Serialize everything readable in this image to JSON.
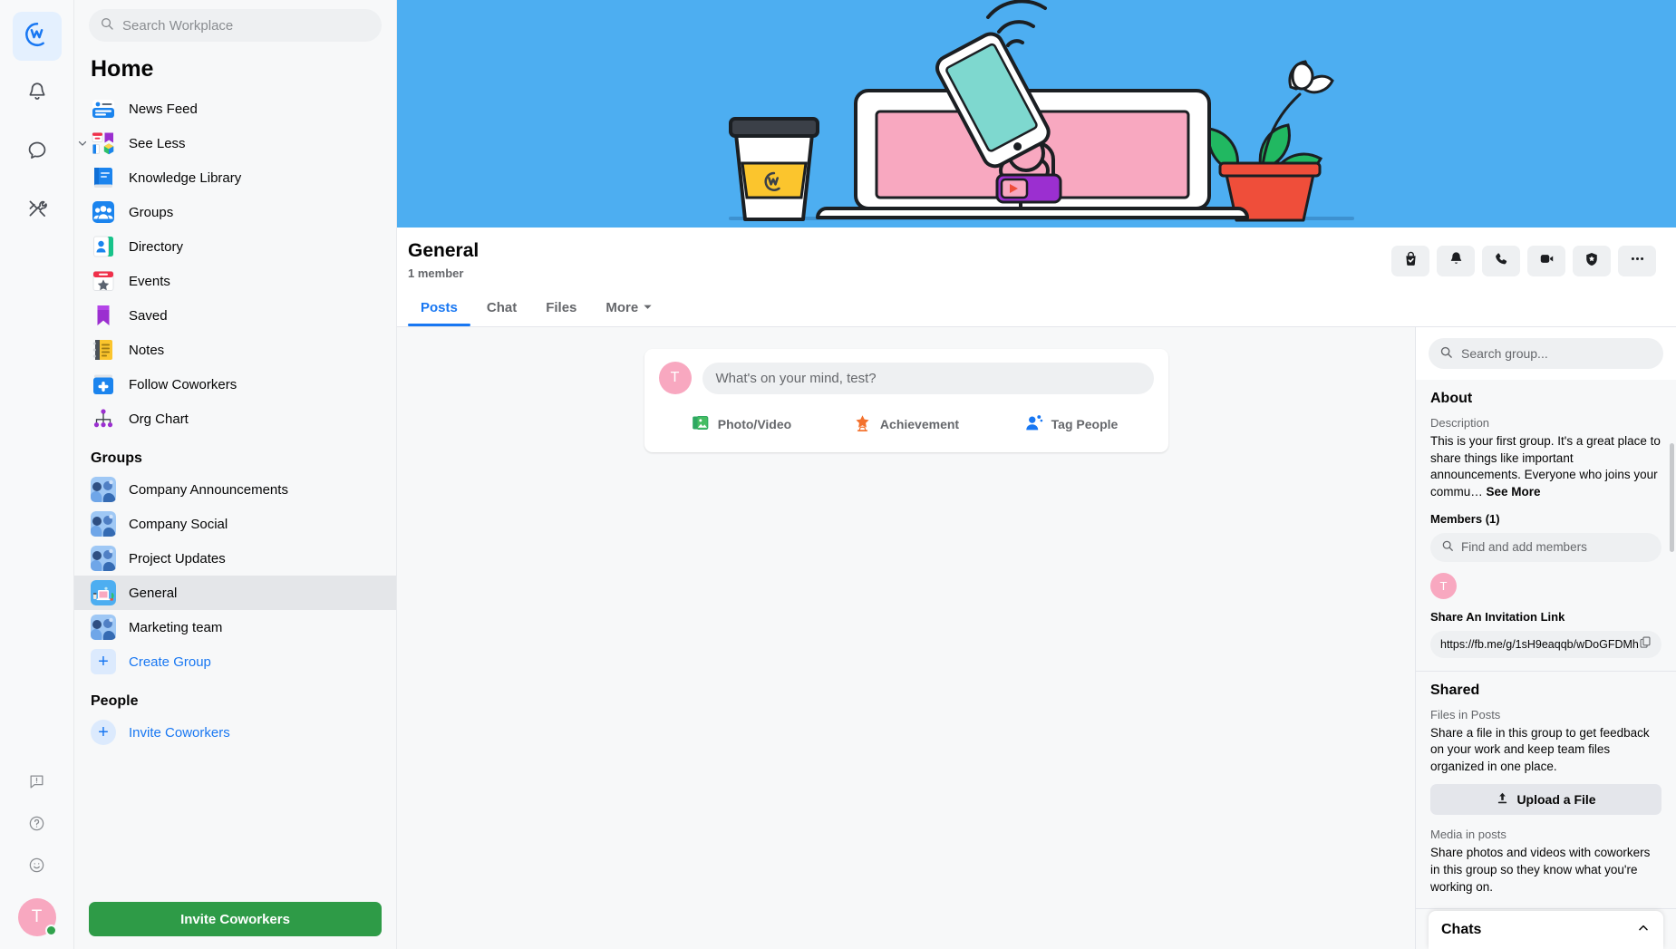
{
  "rail": {
    "items": [
      {
        "name": "workplace-home",
        "icon": "workplace-logo-icon",
        "active": true
      },
      {
        "name": "notifications",
        "icon": "bell-icon",
        "active": false
      },
      {
        "name": "chat",
        "icon": "chat-bubble-icon",
        "active": false
      },
      {
        "name": "tools",
        "icon": "tools-icon",
        "active": false
      }
    ],
    "bottom": [
      {
        "name": "feedback",
        "icon": "feedback-icon"
      },
      {
        "name": "help",
        "icon": "help-icon"
      },
      {
        "name": "emoji-status",
        "icon": "smiley-icon"
      }
    ],
    "avatar_initial": "T"
  },
  "search": {
    "placeholder": "Search Workplace",
    "value": ""
  },
  "sidebar": {
    "title": "Home",
    "nav": [
      {
        "label": "News Feed",
        "icon": "news-feed-icon",
        "chevron": false
      },
      {
        "label": "See Less",
        "icon": "see-less-icon",
        "chevron": true
      },
      {
        "label": "Knowledge Library",
        "icon": "knowledge-library-icon",
        "chevron": false
      },
      {
        "label": "Groups",
        "icon": "groups-icon",
        "chevron": false
      },
      {
        "label": "Directory",
        "icon": "directory-icon",
        "chevron": false
      },
      {
        "label": "Events",
        "icon": "events-icon",
        "chevron": false
      },
      {
        "label": "Saved",
        "icon": "saved-icon",
        "chevron": false
      },
      {
        "label": "Notes",
        "icon": "notes-icon",
        "chevron": false
      },
      {
        "label": "Follow Coworkers",
        "icon": "follow-coworkers-icon",
        "chevron": false
      },
      {
        "label": "Org Chart",
        "icon": "org-chart-icon",
        "chevron": false
      }
    ],
    "groups_heading": "Groups",
    "groups": [
      {
        "label": "Company Announcements",
        "selected": false
      },
      {
        "label": "Company Social",
        "selected": false
      },
      {
        "label": "Project Updates",
        "selected": false
      },
      {
        "label": "General",
        "selected": true
      },
      {
        "label": "Marketing team",
        "selected": false
      }
    ],
    "create_group": "Create Group",
    "people_heading": "People",
    "invite_coworkers_link": "Invite Coworkers",
    "invite_coworkers_button": "Invite Coworkers"
  },
  "group": {
    "name": "General",
    "members_text": "1 member",
    "tabs": [
      {
        "label": "Posts",
        "active": true,
        "caret": false
      },
      {
        "label": "Chat",
        "active": false,
        "caret": false
      },
      {
        "label": "Files",
        "active": false,
        "caret": false
      },
      {
        "label": "More",
        "active": false,
        "caret": true
      }
    ],
    "actions": [
      {
        "name": "joined-button",
        "icon": "joined-bag-check-icon"
      },
      {
        "name": "notifications-button",
        "icon": "bell-icon"
      },
      {
        "name": "audio-call-button",
        "icon": "phone-icon"
      },
      {
        "name": "video-call-button",
        "icon": "video-camera-icon"
      },
      {
        "name": "group-badge-button",
        "icon": "shield-star-icon"
      },
      {
        "name": "more-options-button",
        "icon": "ellipsis-icon"
      }
    ]
  },
  "composer": {
    "avatar_initial": "T",
    "placeholder": "What's on your mind, test?",
    "actions": [
      {
        "label": "Photo/Video",
        "icon": "photo-video-icon",
        "color": "#45bd62"
      },
      {
        "label": "Achievement",
        "icon": "achievement-star-icon",
        "color": "#f3712d"
      },
      {
        "label": "Tag People",
        "icon": "tag-people-icon",
        "color": "#1877f2"
      }
    ]
  },
  "right_panel": {
    "search_placeholder": "Search group...",
    "about": {
      "title": "About",
      "description_label": "Description",
      "description": "This is your first group. It's a great place to share things like important announcements. Everyone who joins your commu…",
      "see_more": "See More",
      "members_label": "Members (1)",
      "find_members_placeholder": "Find and add members",
      "member_initial": "T",
      "invite_link_label": "Share An Invitation Link",
      "invite_link": "https://fb.me/g/1sH9eaqqb/wDoGFDMh"
    },
    "shared": {
      "title": "Shared",
      "files_label": "Files in Posts",
      "files_text": "Share a file in this group to get feedback on your work and keep team files organized in one place.",
      "upload_button": "Upload a File",
      "media_label": "Media in posts",
      "media_text": "Share photos and videos with coworkers in this group so they know what you're working on."
    },
    "chats_bar": {
      "label": "Chats",
      "icon": "chevron-up-icon"
    }
  },
  "colors": {
    "accent_blue": "#1877f2",
    "cover_blue": "#4daef1",
    "invite_green": "#2e9b47",
    "avatar_pink": "#f8a8c0",
    "presence_green": "#31a24c"
  }
}
